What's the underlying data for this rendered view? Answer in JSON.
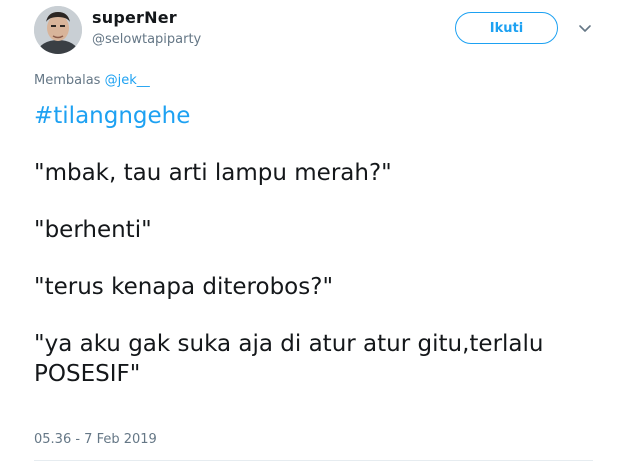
{
  "tweet": {
    "display_name": "superNer",
    "handle": "@selowtapiparty",
    "follow_label": "Ikuti",
    "reply_prefix": "Membalas ",
    "reply_mention": "@jek__",
    "hashtag": "#tilangngehe",
    "lines": [
      "\"mbak, tau arti lampu merah?\"",
      "\"berhenti\"",
      "\"terus kenapa diterobos?\"",
      "\"ya aku gak suka aja di atur atur gitu,terlalu POSESIF\""
    ],
    "timestamp": "05.36 - 7 Feb 2019",
    "icons": {
      "caret": "chevron-down-icon",
      "avatar": "avatar"
    },
    "colors": {
      "accent": "#1da1f2",
      "text": "#14171a",
      "muted": "#657786"
    }
  }
}
